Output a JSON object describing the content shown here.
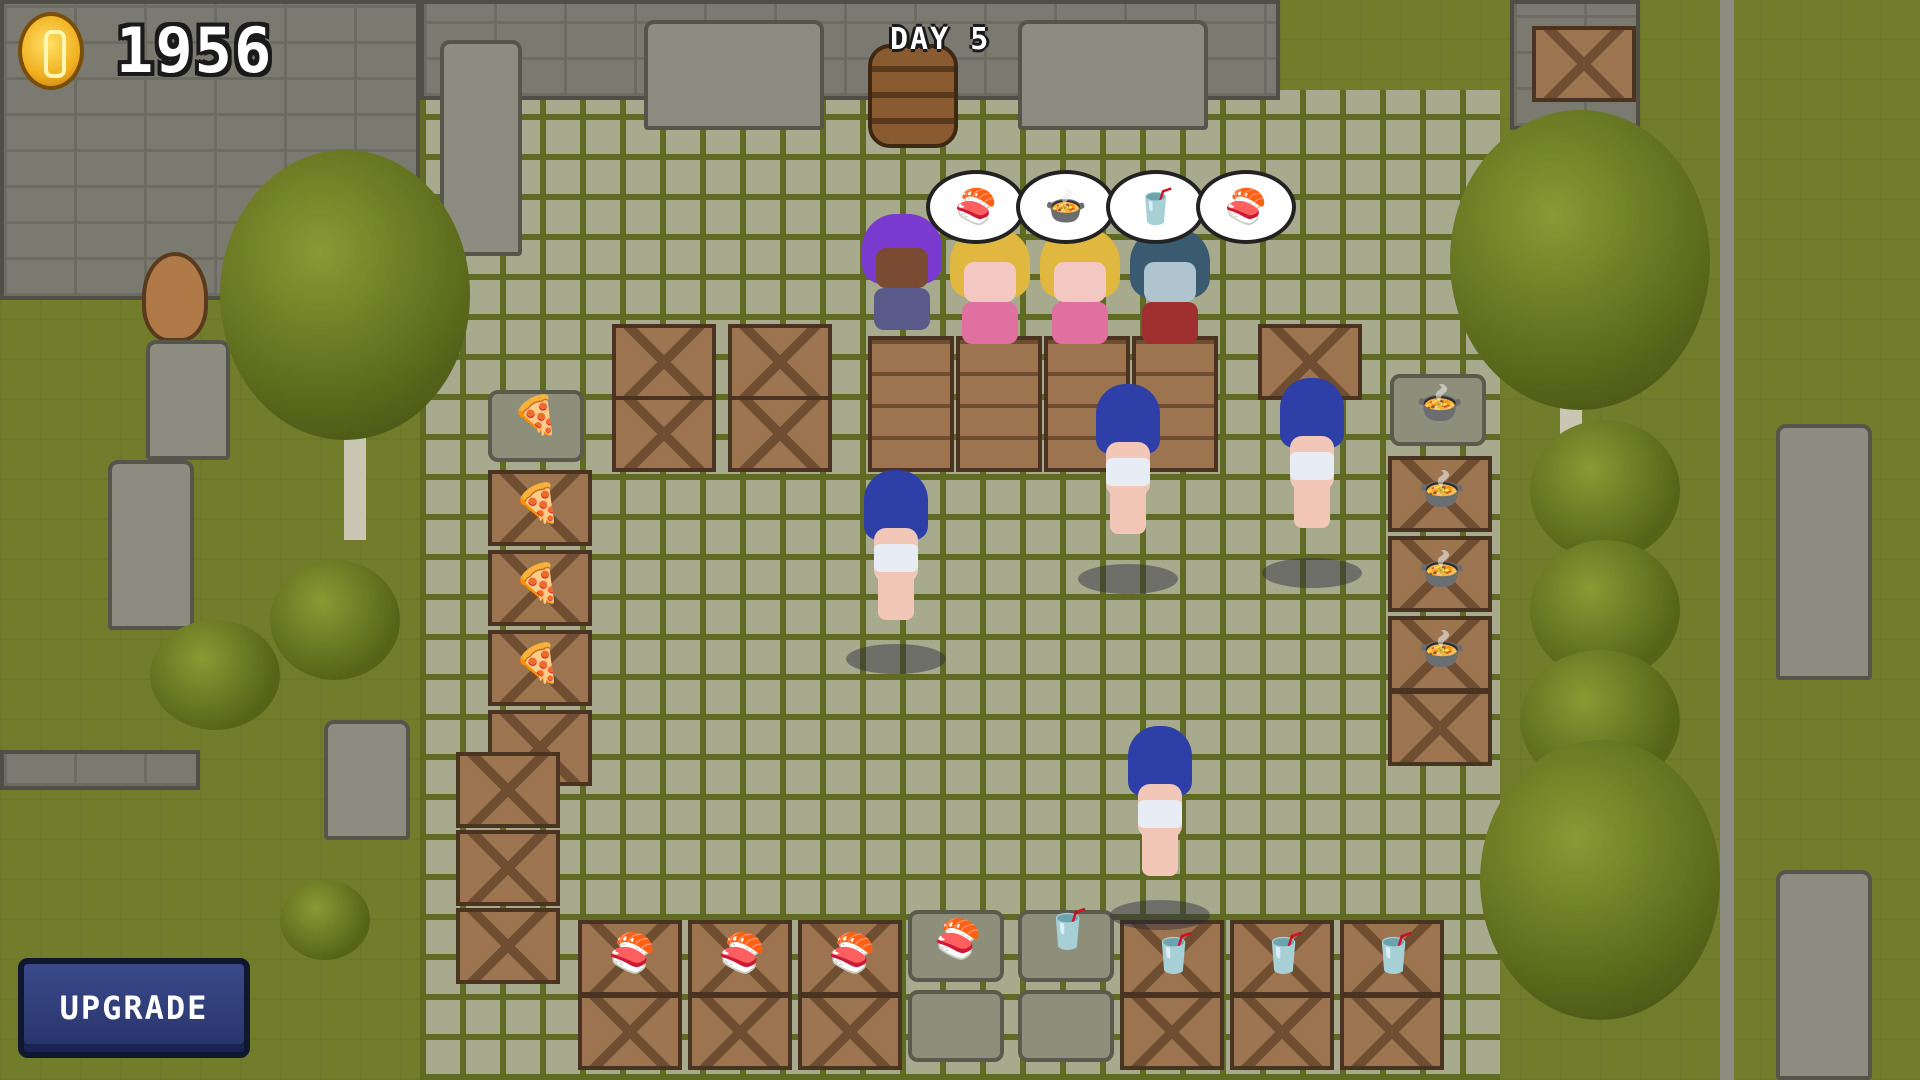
{
  "hud": {
    "coins": "1956",
    "day": "DAY 5",
    "upgrade_label": "UPGRADE"
  },
  "orders": [
    "sushi",
    "soup",
    "drink",
    "sushi"
  ],
  "stations": {
    "left_column": [
      "pizza",
      "pizza-tray",
      "pizza-tray",
      "pizza-tray"
    ],
    "right_column": [
      "soup",
      "soup-pot",
      "soup-pot",
      "soup-pot"
    ],
    "bottom_row": [
      "sushi-tray",
      "sushi-tray",
      "sushi-tray",
      "sushi",
      "drink",
      "drink-tray",
      "drink-tray",
      "drink-tray"
    ]
  },
  "icons": {
    "sushi": "🍣",
    "soup": "🍲",
    "drink": "🥤",
    "pizza": "🍕"
  }
}
